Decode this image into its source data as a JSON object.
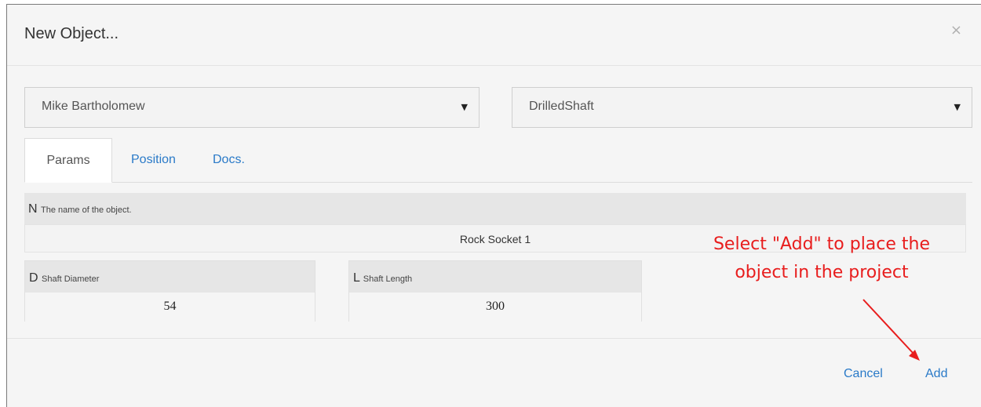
{
  "dialog": {
    "title": "New Object...",
    "close_symbol": "×"
  },
  "selects": {
    "owner": {
      "value": "Mike Bartholomew",
      "caret": "▼"
    },
    "object_type": {
      "value": "DrilledShaft",
      "caret": "▼"
    }
  },
  "tabs": [
    {
      "label": "Params",
      "active": true
    },
    {
      "label": "Position",
      "active": false
    },
    {
      "label": "Docs.",
      "active": false
    }
  ],
  "params": {
    "name": {
      "code": "N",
      "desc": "The name of the object.",
      "value": "Rock Socket 1"
    },
    "diameter": {
      "code": "D",
      "desc": "Shaft Diameter",
      "value": "54"
    },
    "length": {
      "code": "L",
      "desc": "Shaft Length",
      "value": "300"
    }
  },
  "footer": {
    "cancel_label": "Cancel",
    "add_label": "Add"
  },
  "annotation": {
    "line1": "Select \"Add\" to place the",
    "line2": "object in the project",
    "color": "#e81d1d"
  },
  "colors": {
    "link": "#2a7ac8",
    "dialog_bg": "#f5f5f5"
  }
}
